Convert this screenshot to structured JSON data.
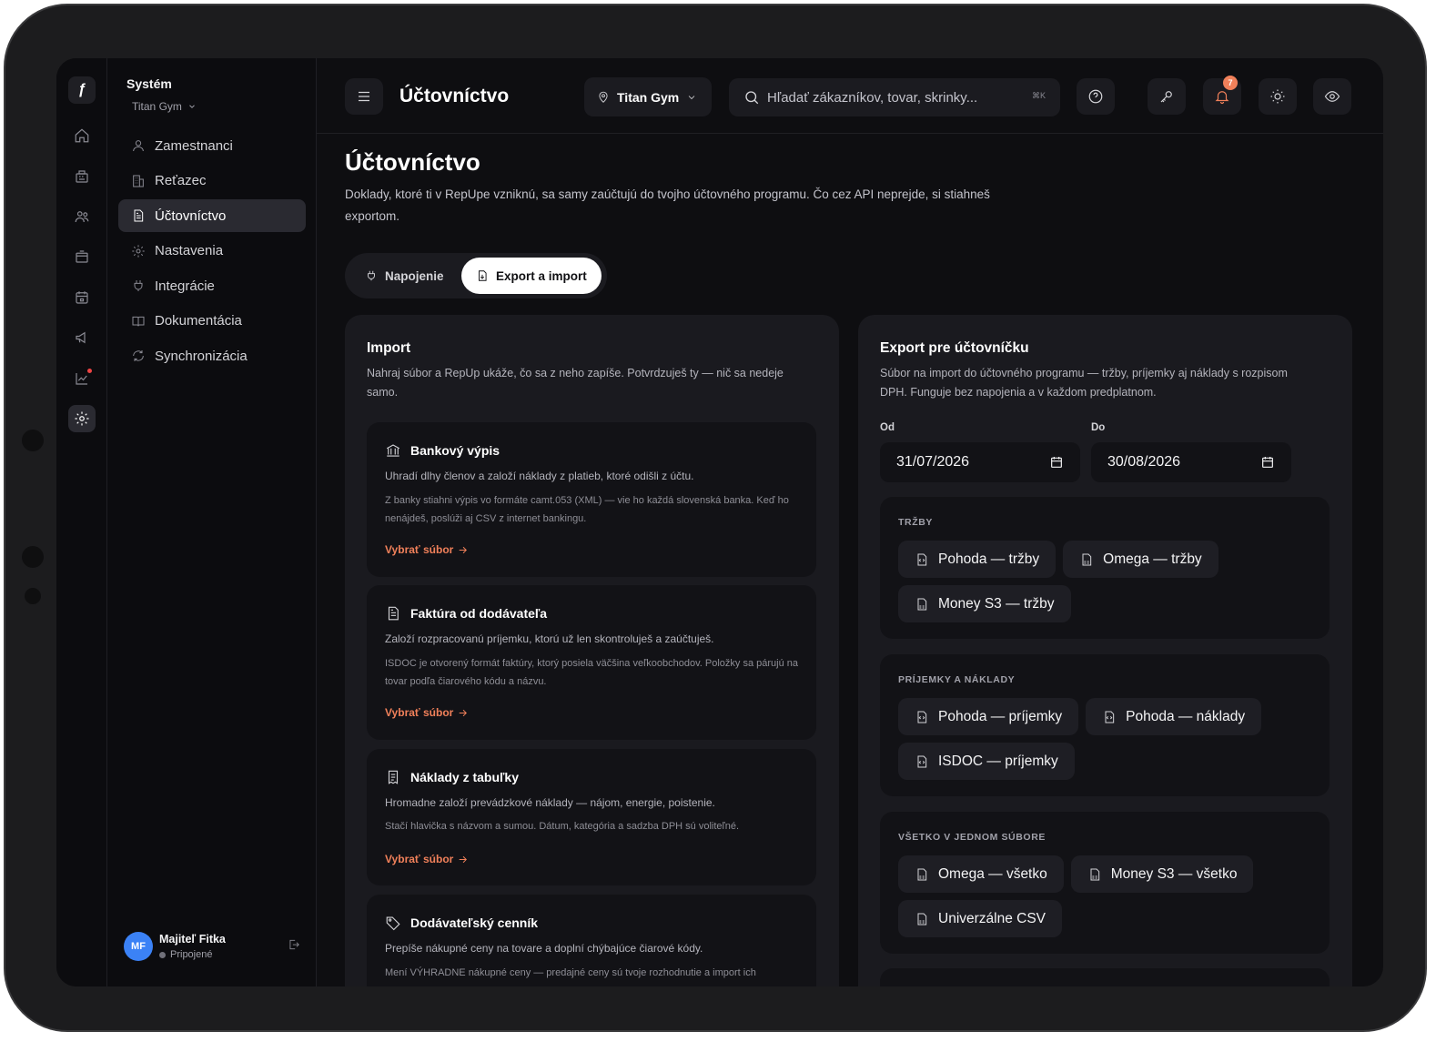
{
  "sidebar": {
    "title": "Systém",
    "gym": "Titan Gym",
    "items": [
      {
        "label": "Zamestnanci",
        "icon": "user-icon"
      },
      {
        "label": "Reťazec",
        "icon": "building-icon"
      },
      {
        "label": "Účtovníctvo",
        "icon": "document-icon",
        "active": true
      },
      {
        "label": "Nastavenia",
        "icon": "gear-icon"
      },
      {
        "label": "Integrácie",
        "icon": "plug-icon"
      },
      {
        "label": "Dokumentácia",
        "icon": "book-icon"
      },
      {
        "label": "Synchronizácia",
        "icon": "sync-icon"
      }
    ],
    "user": {
      "initials": "MF",
      "name": "Majiteľ Fitka",
      "status": "Pripojené"
    }
  },
  "topbar": {
    "title": "Účtovníctvo",
    "location": "Titan Gym",
    "search_placeholder": "Hľadať zákazníkov, tovar, skrinky...",
    "shortcut": "⌘K",
    "notifications": "7"
  },
  "page": {
    "title": "Účtovníctvo",
    "description": "Doklady, ktoré ti v RepUpe vzniknú, sa samy zaúčtujú do tvojho účtovného programu. Čo cez API neprejde, si stiahneš exportom.",
    "tabs": [
      {
        "label": "Napojenie",
        "active": false
      },
      {
        "label": "Export a import",
        "active": true
      }
    ]
  },
  "import": {
    "title": "Import",
    "description": "Nahraj súbor a RepUp ukáže, čo sa z neho zapíše. Potvrdzuješ ty — nič sa nedeje samo.",
    "items": [
      {
        "title": "Bankový výpis",
        "line1": "Uhradí dlhy členov a založí náklady z platieb, ktoré odišli z účtu.",
        "line2": "Z banky stiahni výpis vo formáte camt.053 (XML) — vie ho každá slovenská banka. Keď ho nenájdeš, poslúži aj CSV z internet bankingu.",
        "link": "Vybrať súbor"
      },
      {
        "title": "Faktúra od dodávateľa",
        "line1": "Založí rozpracovanú príjemku, ktorú už len skontroluješ a zaúčtuješ.",
        "line2": "ISDOC je otvorený formát faktúry, ktorý posiela väčšina veľkoobchodov. Položky sa párujú na tovar podľa čiarového kódu a názvu.",
        "link": "Vybrať súbor"
      },
      {
        "title": "Náklady z tabuľky",
        "line1": "Hromadne založí prevádzkové náklady — nájom, energie, poistenie.",
        "line2": "Stačí hlavička s názvom a sumou. Dátum, kategória a sadzba DPH sú voliteľné.",
        "link": "Vybrať súbor"
      },
      {
        "title": "Dodávateľský cenník",
        "line1": "Prepíše nákupné ceny na tovare a doplní chýbajúce čiarové kódy.",
        "line2": "Mení VÝHRADNE nákupné ceny — predajné ceny sú tvoje rozhodnutie a import ich"
      }
    ]
  },
  "export": {
    "title": "Export pre účtovníčku",
    "description": "Súbor na import do účtovného programu — tržby, príjemky aj náklady s rozpisom DPH. Funguje bez napojenia a v každom predplatnom.",
    "from_label": "Od",
    "from_value": "31/07/2026",
    "to_label": "Do",
    "to_value": "30/08/2026",
    "groups": [
      {
        "label": "TRŽBY",
        "chips": [
          {
            "label": "Pohoda — tržby",
            "icon": "xml-file-icon"
          },
          {
            "label": "Omega — tržby",
            "icon": "csv-file-icon"
          },
          {
            "label": "Money S3 — tržby",
            "icon": "csv-file-icon"
          }
        ]
      },
      {
        "label": "PRÍJEMKY A NÁKLADY",
        "chips": [
          {
            "label": "Pohoda — príjemky",
            "icon": "xml-file-icon"
          },
          {
            "label": "Pohoda — náklady",
            "icon": "xml-file-icon"
          },
          {
            "label": "ISDOC — príjemky",
            "icon": "xml-file-icon"
          }
        ]
      },
      {
        "label": "VŠETKO V JEDNOM SÚBORE",
        "chips": [
          {
            "label": "Omega — všetko",
            "icon": "csv-file-icon"
          },
          {
            "label": "Money S3 — všetko",
            "icon": "csv-file-icon"
          },
          {
            "label": "Univerzálne CSV",
            "icon": "csv-file-icon"
          }
        ]
      }
    ]
  }
}
